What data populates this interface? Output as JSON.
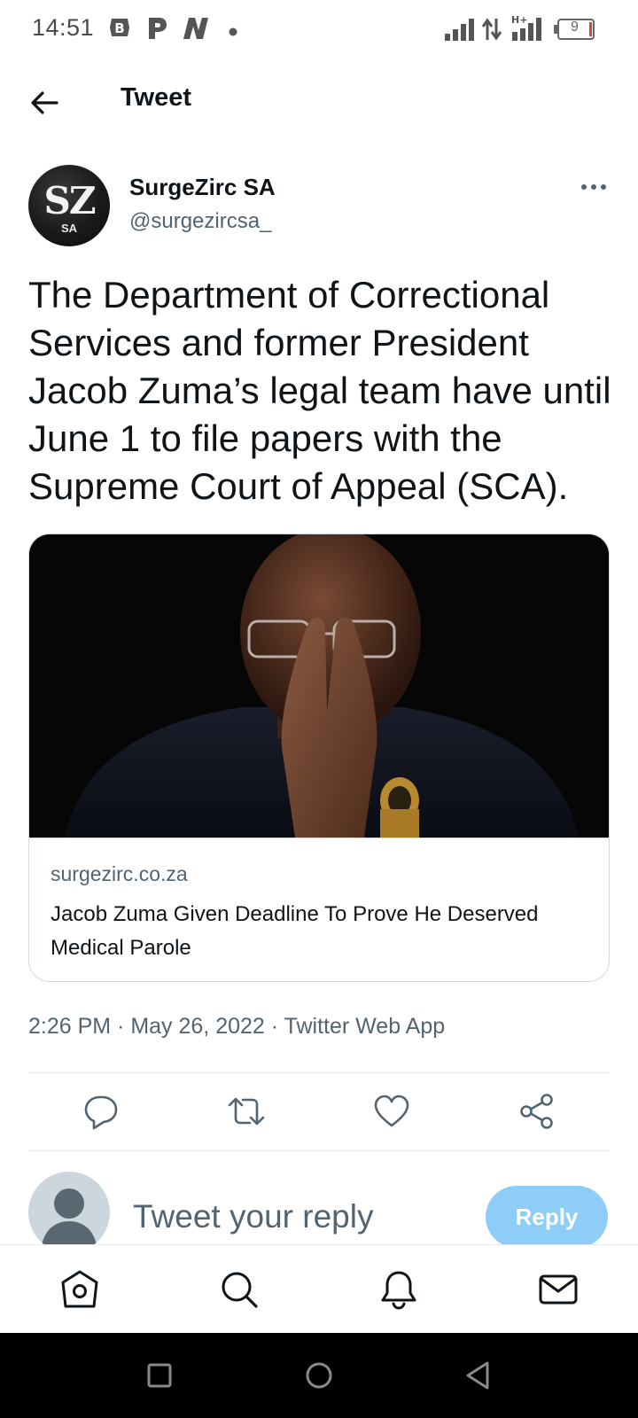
{
  "status_bar": {
    "time": "14:51",
    "battery_level": "9",
    "icons": [
      "browser-app-icon",
      "p-app-icon",
      "n-app-icon",
      "notification-dot-icon",
      "signal-icon",
      "data-transfer-icon",
      "hplus-signal-icon",
      "battery-icon"
    ]
  },
  "header": {
    "title": "Tweet"
  },
  "author": {
    "name": "SurgeZirc SA",
    "handle": "@surgezircsa_",
    "avatar_text": "SZ",
    "avatar_subtext": "SA"
  },
  "tweet": {
    "text": "The Department of Correctional Services and former President Jacob Zuma’s legal team have until June 1 to file papers with the Supreme Court of Appeal (SCA).",
    "meta": "2:26 PM · May 26, 2022 · Twitter Web App"
  },
  "link_card": {
    "domain": "surgezirc.co.za",
    "title": "Jacob Zuma Given Deadline To Prove He Deserved Medical Parole"
  },
  "actions": [
    "reply-icon",
    "retweet-icon",
    "like-icon",
    "share-icon"
  ],
  "composer": {
    "placeholder": "Tweet your reply",
    "button_label": "Reply"
  },
  "tabs": [
    "home-icon",
    "search-icon",
    "notifications-icon",
    "messages-icon"
  ],
  "colors": {
    "accent": "#1d9bf0",
    "reply_button_disabled": "#8ecdf8",
    "secondary_text": "#536471",
    "primary_text": "#0f1419"
  }
}
